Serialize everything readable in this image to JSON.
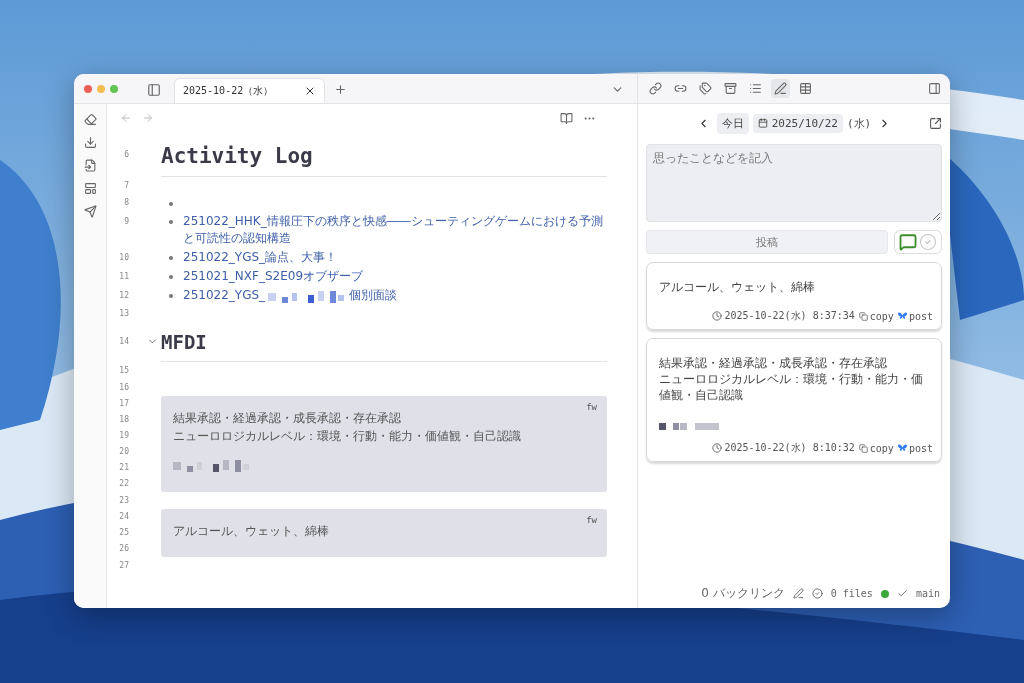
{
  "window": {
    "tab": {
      "title": "2025-10-22（水）",
      "selected": true
    }
  },
  "sidebar": {
    "tools": [
      {
        "kind": "eraser"
      },
      {
        "kind": "download"
      },
      {
        "kind": "file-import"
      },
      {
        "kind": "layout"
      },
      {
        "kind": "send"
      }
    ]
  },
  "editor": {
    "blocks": [
      {
        "kind": "heading",
        "lines": [
          "6"
        ],
        "text": "Activity Log"
      },
      {
        "kind": "blank",
        "lines": [
          "7"
        ]
      },
      {
        "kind": "empty-bullet",
        "lines": [
          "8"
        ]
      },
      {
        "kind": "link",
        "lines": [
          "9"
        ],
        "text": "251022_HHK_情報圧下の秩序と快感――シューティングゲームにおける予測と可読性の認知構造"
      },
      {
        "kind": "link",
        "lines": [
          "10"
        ],
        "text": "251022_YGS_論点、大事！"
      },
      {
        "kind": "link",
        "lines": [
          "11"
        ],
        "text": "251021_NXF_S2E09オブザーブ"
      },
      {
        "kind": "redacted-link",
        "lines": [
          "12"
        ],
        "text": "251022_YGS_",
        "after": "個別面談"
      },
      {
        "kind": "blank",
        "lines": [
          "13"
        ]
      },
      {
        "kind": "heading",
        "lines": [
          "14"
        ],
        "text": "MFDI",
        "expanded": true
      },
      {
        "kind": "blank",
        "lines": [
          "15"
        ]
      },
      {
        "kind": "blank",
        "lines": [
          "16"
        ]
      },
      {
        "kind": "callout",
        "lines": [
          "17",
          "18",
          "19",
          "20",
          "21",
          "22"
        ],
        "label": "fw",
        "paragraphs": [
          "結果承認・経過承認・成長承認・存在承認",
          "ニューロロジカルレベル：環境・行動・能力・価値観・自己認識"
        ],
        "redacted": true
      },
      {
        "kind": "blank",
        "lines": [
          "23"
        ]
      },
      {
        "kind": "callout",
        "lines": [
          "24",
          "25",
          "26"
        ],
        "label": "fw",
        "paragraphs": [
          "アルコール、ウェット、綿棒"
        ],
        "redacted": false
      },
      {
        "kind": "blank",
        "lines": [
          "27"
        ]
      }
    ]
  },
  "right_panel": {
    "toolbar": [
      {
        "kind": "link-add",
        "selected": false
      },
      {
        "kind": "link-out",
        "selected": false
      },
      {
        "kind": "tags",
        "selected": false
      },
      {
        "kind": "archive",
        "selected": false
      },
      {
        "kind": "list",
        "selected": false
      },
      {
        "kind": "pen",
        "selected": true
      },
      {
        "kind": "table",
        "selected": false
      }
    ],
    "date_nav": {
      "today": "今日",
      "date": "2025/10/22",
      "weekday": "(水)"
    },
    "composer": {
      "placeholder": "思ったことなどを記入",
      "button": "投稿",
      "modes": [
        {
          "kind": "comment",
          "selected": true
        },
        {
          "kind": "check",
          "selected": false
        }
      ]
    },
    "cards": [
      {
        "paragraphs": [
          "アルコール、ウェット、綿棒"
        ],
        "redacted": false,
        "time": "2025-10-22(水) 8:37:34",
        "copy": "copy",
        "post": "post"
      },
      {
        "paragraphs": [
          "結果承認・経過承認・成長承認・存在承認",
          "ニューロロジカルレベル：環境・行動・能力・価値観・自己認識"
        ],
        "redacted": true,
        "time": "2025-10-22(水) 8:10:32",
        "copy": "copy",
        "post": "post"
      }
    ]
  },
  "status_bar": {
    "backlinks": "0 バックリンク",
    "files": "0 files",
    "synced": true,
    "branch": "main"
  }
}
